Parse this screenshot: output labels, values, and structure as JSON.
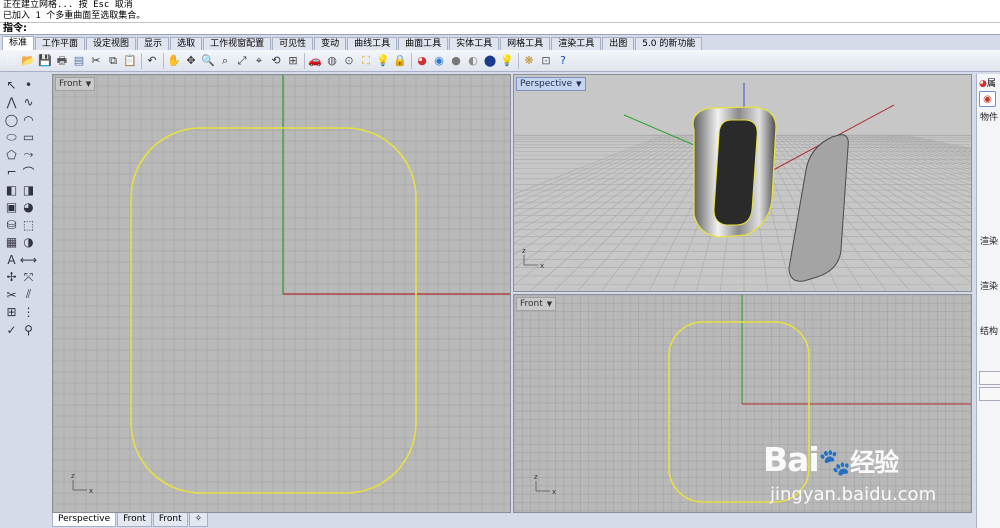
{
  "command": {
    "history_line1": "正在建立网格... 按 Esc 取消",
    "history_line2": "已加入 1 个多重曲面至选取集合。",
    "prompt_label": "指令:"
  },
  "tabs": [
    {
      "label": "标准",
      "active": true
    },
    {
      "label": "工作平面",
      "active": false
    },
    {
      "label": "设定视图",
      "active": false
    },
    {
      "label": "显示",
      "active": false
    },
    {
      "label": "选取",
      "active": false
    },
    {
      "label": "工作视窗配置",
      "active": false
    },
    {
      "label": "可见性",
      "active": false
    },
    {
      "label": "变动",
      "active": false
    },
    {
      "label": "曲线工具",
      "active": false
    },
    {
      "label": "曲面工具",
      "active": false
    },
    {
      "label": "实体工具",
      "active": false
    },
    {
      "label": "网格工具",
      "active": false
    },
    {
      "label": "渲染工具",
      "active": false
    },
    {
      "label": "出图",
      "active": false
    },
    {
      "label": "5.0 的新功能",
      "active": false
    }
  ],
  "toolbar_icons": [
    {
      "name": "new-file-icon",
      "glyph": "🗋",
      "color": "#ffffff"
    },
    {
      "name": "open-file-icon",
      "glyph": "📂",
      "color": "#f0c24a"
    },
    {
      "name": "save-file-icon",
      "glyph": "💾",
      "color": "#3a5fa8"
    },
    {
      "name": "print-icon",
      "glyph": "🖶",
      "color": "#555"
    },
    {
      "name": "properties-icon",
      "glyph": "▤",
      "color": "#5577aa"
    },
    {
      "name": "cut-icon",
      "glyph": "✂",
      "color": "#333"
    },
    {
      "name": "copy-icon",
      "glyph": "⧉",
      "color": "#333"
    },
    {
      "name": "paste-icon",
      "glyph": "📋",
      "color": "#c9a24a"
    },
    {
      "name": "undo-icon",
      "glyph": "↶",
      "color": "#333"
    },
    {
      "name": "pan-icon",
      "glyph": "✋",
      "color": "#c58a4a"
    },
    {
      "name": "rotate-view-icon",
      "glyph": "✥",
      "color": "#333"
    },
    {
      "name": "zoom-icon",
      "glyph": "🔍",
      "color": "#333"
    },
    {
      "name": "zoom-window-icon",
      "glyph": "⌕",
      "color": "#333"
    },
    {
      "name": "zoom-extents-icon",
      "glyph": "⤢",
      "color": "#333"
    },
    {
      "name": "zoom-selected-icon",
      "glyph": "⌖",
      "color": "#333"
    },
    {
      "name": "undo-view-icon",
      "glyph": "⟲",
      "color": "#333"
    },
    {
      "name": "four-views-icon",
      "glyph": "⊞",
      "color": "#444"
    },
    {
      "name": "set-camera-icon",
      "glyph": "🚗",
      "color": "#c33"
    },
    {
      "name": "named-views-icon",
      "glyph": "◍",
      "color": "#555"
    },
    {
      "name": "snapshot-icon",
      "glyph": "⊙",
      "color": "#555"
    },
    {
      "name": "select-icon",
      "glyph": "⛶",
      "color": "#e0a020"
    },
    {
      "name": "light-icon",
      "glyph": "💡",
      "color": "#888"
    },
    {
      "name": "lock-icon",
      "glyph": "🔒",
      "color": "#555"
    },
    {
      "name": "color-wheel-icon",
      "glyph": "◕",
      "color": "#d03030"
    },
    {
      "name": "color-circle-icon",
      "glyph": "◉",
      "color": "#2a7ad0"
    },
    {
      "name": "shade-sphere-icon",
      "glyph": "●",
      "color": "#777"
    },
    {
      "name": "render-sphere-icon",
      "glyph": "◐",
      "color": "#888"
    },
    {
      "name": "rendered-sphere-icon",
      "glyph": "⬤",
      "color": "#1a3a8a"
    },
    {
      "name": "light-bulb-icon",
      "glyph": "💡",
      "color": "#e8c030"
    },
    {
      "name": "texture-icon",
      "glyph": "❋",
      "color": "#c09030"
    },
    {
      "name": "layout-icon",
      "glyph": "⊡",
      "color": "#555"
    },
    {
      "name": "help-icon",
      "glyph": "?",
      "color": "#1a4ab0"
    }
  ],
  "left_tools": [
    {
      "name": "select-arrow-icon",
      "glyph": "↖"
    },
    {
      "name": "point-icon",
      "glyph": "•"
    },
    {
      "name": "polyline-icon",
      "glyph": "⋀"
    },
    {
      "name": "curve-icon",
      "glyph": "∿"
    },
    {
      "name": "circle-icon",
      "glyph": "◯"
    },
    {
      "name": "arc-icon",
      "glyph": "◠"
    },
    {
      "name": "ellipse-icon",
      "glyph": "⬭"
    },
    {
      "name": "rectangle-icon",
      "glyph": "▭"
    },
    {
      "name": "polygon-icon",
      "glyph": "⬠"
    },
    {
      "name": "freeform-icon",
      "glyph": "⤳"
    },
    {
      "name": "fillet-curve-icon",
      "glyph": "⌐"
    },
    {
      "name": "offset-icon",
      "glyph": "⌒"
    },
    {
      "name": "surface-icon",
      "glyph": "◧"
    },
    {
      "name": "loft-icon",
      "glyph": "◨"
    },
    {
      "name": "box-icon",
      "glyph": "▣"
    },
    {
      "name": "sphere-icon",
      "glyph": "◕"
    },
    {
      "name": "cylinder-icon",
      "glyph": "⛁"
    },
    {
      "name": "extrude-icon",
      "glyph": "⬚"
    },
    {
      "name": "mesh-icon",
      "glyph": "▦"
    },
    {
      "name": "boolean-icon",
      "glyph": "◑"
    },
    {
      "name": "text-icon",
      "glyph": "A"
    },
    {
      "name": "dimension-icon",
      "glyph": "⟷"
    },
    {
      "name": "transform-icon",
      "glyph": "✢"
    },
    {
      "name": "join-icon",
      "glyph": "⤧"
    },
    {
      "name": "trim-icon",
      "glyph": "✂"
    },
    {
      "name": "split-icon",
      "glyph": "⫽"
    },
    {
      "name": "group-icon",
      "glyph": "⊞"
    },
    {
      "name": "array-icon",
      "glyph": "⋮"
    },
    {
      "name": "check-icon",
      "glyph": "✓"
    },
    {
      "name": "analysis-icon",
      "glyph": "⚲"
    }
  ],
  "viewports": {
    "front_large": {
      "label": "Front"
    },
    "perspective": {
      "label": "Perspective"
    },
    "front_small": {
      "label": "Front"
    }
  },
  "axis_labels": {
    "x": "x",
    "y": "y",
    "z": "z"
  },
  "bottom_tabs": [
    {
      "label": "Perspective",
      "active": true
    },
    {
      "label": "Front",
      "active": false
    },
    {
      "label": "Front",
      "active": false
    },
    {
      "label": "✧",
      "active": false
    }
  ],
  "right_panel": {
    "header": "属",
    "rows": [
      "物件",
      "渲染",
      "渲染",
      "结构"
    ]
  },
  "watermark": {
    "brand": "Bai",
    "brand_tail": "经验",
    "url": "jingyan.baidu.com"
  },
  "colors": {
    "grid_bg": "#b9b9b9",
    "grid_line": "#a8a8a8",
    "curve": "#e8e040",
    "axis_x": "#b03030",
    "axis_y": "#2aa02a",
    "axis_z": "#3050c0"
  }
}
